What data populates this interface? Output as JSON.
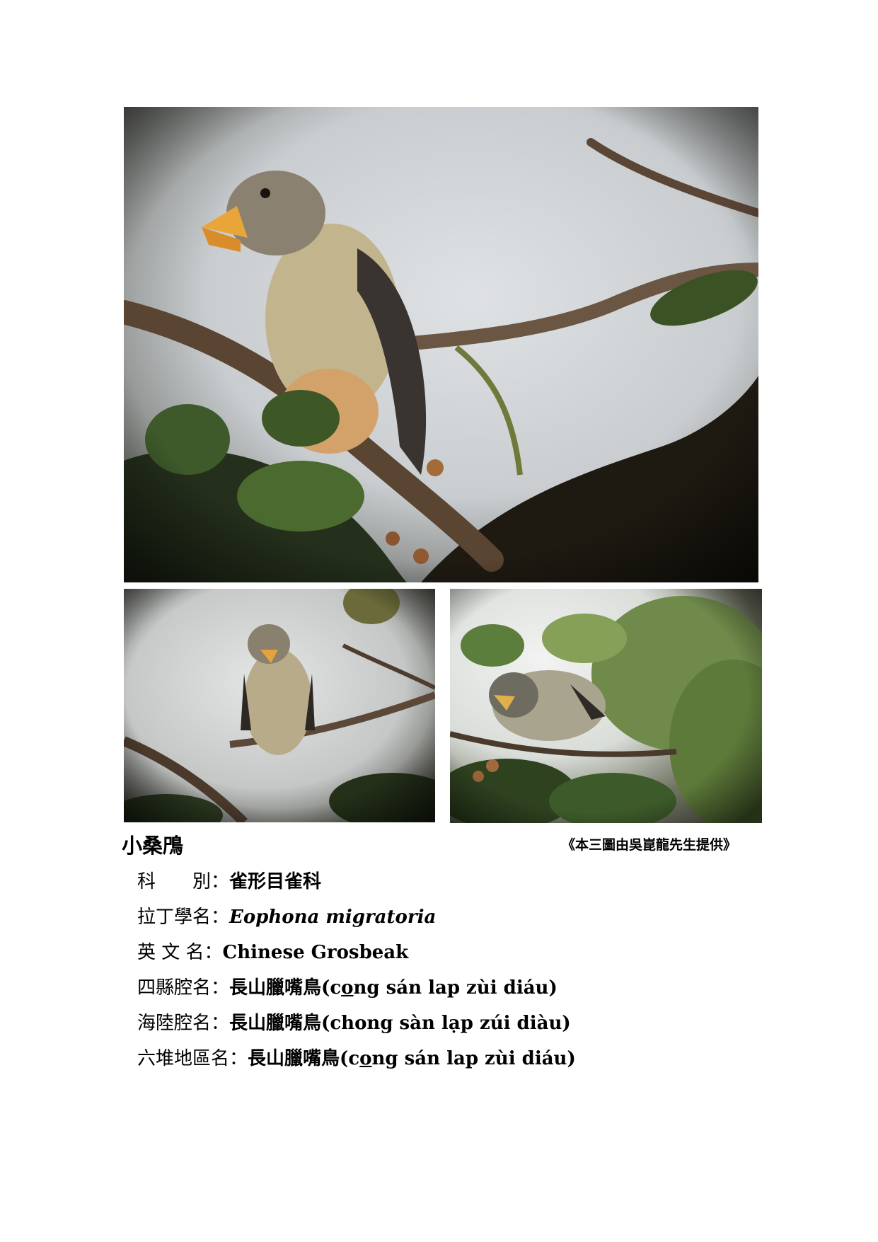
{
  "species_title": "小桑鳲",
  "photo_credit": "《本三圖由吳崑龍先生提供》",
  "fields": [
    {
      "label": "科　　別：",
      "value": "雀形目雀科",
      "style": "plain"
    },
    {
      "label": "拉丁學名：",
      "value": "Eophona migratoria",
      "style": "latin"
    },
    {
      "label": "英 文 名：",
      "value": "Chinese Grosbeak",
      "style": "plain"
    }
  ],
  "dialect_names": [
    {
      "label": "四縣腔名：",
      "chars": "長山臘嘴鳥",
      "pre": "(c",
      "underlined": "o",
      "post": "ng sán lap zùi diáu)"
    },
    {
      "label": "海陸腔名：",
      "chars": "長山臘嘴鳥",
      "pre": "(chong sàn lạp zúi diàu)",
      "underlined": "",
      "post": ""
    },
    {
      "label": "六堆地區名：",
      "chars": "長山臘嘴鳥",
      "pre": "(c",
      "underlined": "o",
      "post": "ng sán lap zùi diáu)"
    }
  ],
  "photos": [
    {
      "id": "main",
      "subject": "bird perched on branch, side view"
    },
    {
      "id": "left",
      "subject": "bird perched facing forward"
    },
    {
      "id": "right",
      "subject": "bird among leaves"
    }
  ]
}
